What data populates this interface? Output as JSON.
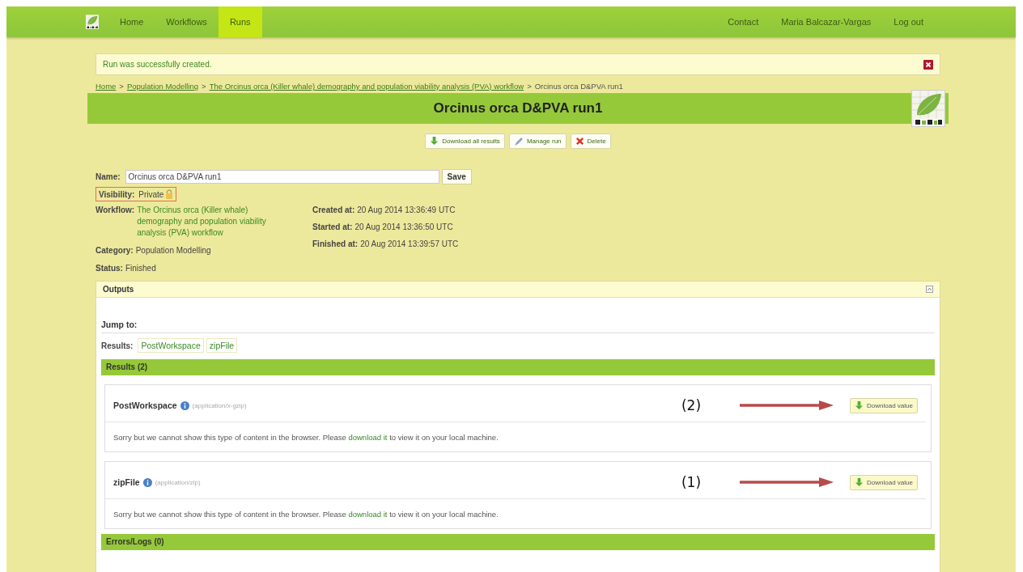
{
  "nav": {
    "left": [
      {
        "label": "Home",
        "selected": false
      },
      {
        "label": "Workflows",
        "selected": false
      },
      {
        "label": "Runs",
        "selected": true
      }
    ],
    "right": [
      {
        "label": "Contact"
      },
      {
        "label": "Maria Balcazar-Vargas"
      },
      {
        "label": "Log out"
      }
    ]
  },
  "alert": {
    "message": "Run was successfully created."
  },
  "breadcrumb": {
    "links": [
      "Home",
      "Population Modelling",
      "The Orcinus orca (Killer whale) demography and population viability analysis (PVA) workflow"
    ],
    "separator": ">",
    "current": "Orcinus orca D&PVA run1"
  },
  "title": "Orcinus orca D&PVA run1",
  "actions": [
    {
      "kind": "download",
      "label": "Download all results"
    },
    {
      "kind": "manage",
      "label": "Manage run"
    },
    {
      "kind": "delete",
      "label": "Delete"
    }
  ],
  "name_field": {
    "label": "Name:",
    "value": "Orcinus orca D&PVA run1",
    "button": "Save"
  },
  "visibility": {
    "label": "Visibility:",
    "value": "Private"
  },
  "details_left": [
    {
      "label": "Workflow:",
      "value": "The Orcinus orca (Killer whale) demography and population viability analysis (PVA) workflow",
      "link": true
    },
    {
      "label": "Category:",
      "value": "Population Modelling",
      "link": false
    },
    {
      "label": "Status:",
      "value": "Finished",
      "link": false
    }
  ],
  "details_right": [
    {
      "label": "Created at:",
      "value": "20 Aug 2014 13:36:49 UTC"
    },
    {
      "label": "Started at:",
      "value": "20 Aug 2014 13:36:50 UTC"
    },
    {
      "label": "Finished at:",
      "value": "20 Aug 2014 13:39:57 UTC"
    }
  ],
  "outputs": {
    "title": "Outputs",
    "jump_title": "Jump to:",
    "jump_label": "Results:",
    "jump_links": [
      "PostWorkspace",
      "zipFile"
    ],
    "results_header": "Results (2)",
    "results": [
      {
        "name": "PostWorkspace",
        "type": "(application/x-gzip)",
        "button": "Download value",
        "annotation": "(2)",
        "message_before": "Sorry but we cannot show this type of content in the browser. Please",
        "message_link": "download it",
        "message_after": "to view it on your local machine."
      },
      {
        "name": "zipFile",
        "type": "(application/zip)",
        "button": "Download value",
        "annotation": "(1)",
        "message_before": "Sorry but we cannot show this type of content in the browser. Please",
        "message_link": "download it",
        "message_after": "to view it on your local machine."
      }
    ],
    "errors_header": "Errors/Logs (0)"
  }
}
